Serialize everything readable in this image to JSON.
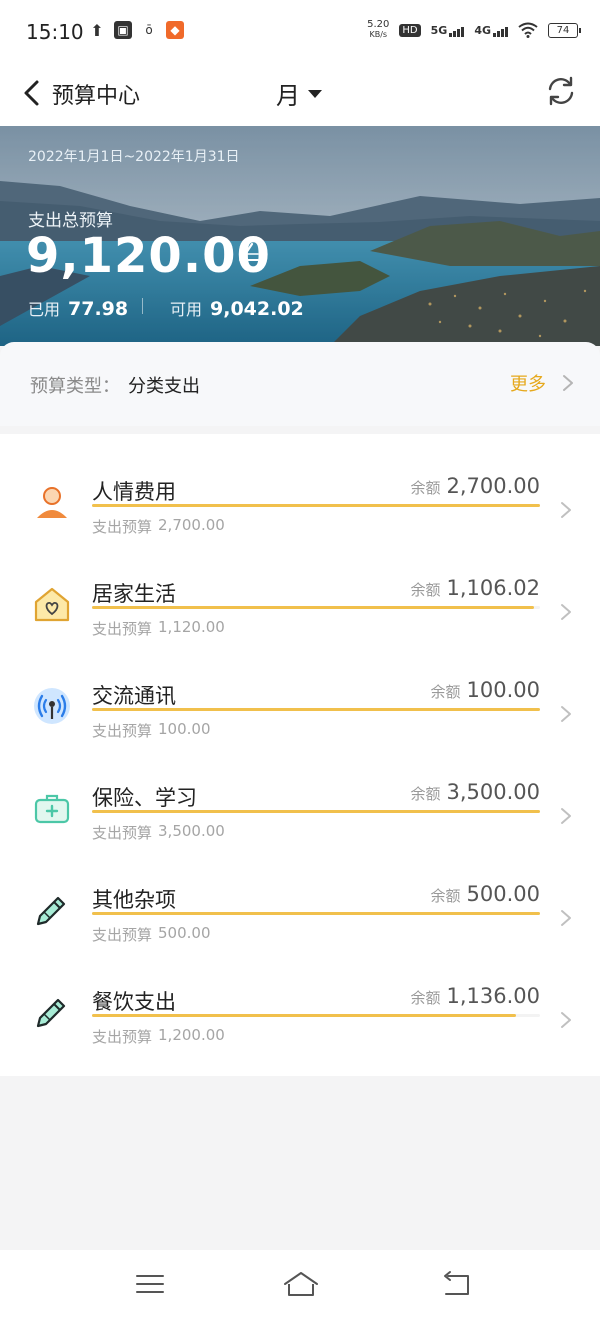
{
  "status_bar": {
    "time": "15:10",
    "speed_value": "5.20",
    "speed_unit": "KB/s",
    "hd_label": "HD",
    "network_1": "5G",
    "network_2": "4G",
    "battery": "74"
  },
  "nav": {
    "title": "预算中心",
    "period": "月",
    "icons": [
      "back-icon",
      "caret-down-icon",
      "refresh-icon"
    ]
  },
  "banner": {
    "date_range": "2022年1月1日~2022年1月31日",
    "total_label": "支出总预算",
    "total_amount": "9,120.00",
    "used_label": "已用",
    "used_value": "77.98",
    "available_label": "可用",
    "available_value": "9,042.02"
  },
  "budget_type": {
    "label": "预算类型：",
    "value": "分类支出",
    "more": "更多"
  },
  "categories": [
    {
      "name": "人情费用",
      "remain_label": "余额",
      "remain": "2,700.00",
      "budget_label": "支出预算",
      "budget": "2,700.00",
      "remaining_fraction": 1.0,
      "icon": "person-icon"
    },
    {
      "name": "居家生活",
      "remain_label": "余额",
      "remain": "1,106.02",
      "budget_label": "支出预算",
      "budget": "1,120.00",
      "remaining_fraction": 0.9875,
      "icon": "home-heart-icon"
    },
    {
      "name": "交流通讯",
      "remain_label": "余额",
      "remain": "100.00",
      "budget_label": "支出预算",
      "budget": "100.00",
      "remaining_fraction": 1.0,
      "icon": "signal-tower-icon"
    },
    {
      "name": "保险、学习",
      "remain_label": "余额",
      "remain": "3,500.00",
      "budget_label": "支出预算",
      "budget": "3,500.00",
      "remaining_fraction": 1.0,
      "icon": "medical-kit-icon"
    },
    {
      "name": "其他杂项",
      "remain_label": "余额",
      "remain": "500.00",
      "budget_label": "支出预算",
      "budget": "500.00",
      "remaining_fraction": 1.0,
      "icon": "pencil-icon"
    },
    {
      "name": "餐饮支出",
      "remain_label": "余额",
      "remain": "1,136.00",
      "budget_label": "支出预算",
      "budget": "1,200.00",
      "remaining_fraction": 0.9467,
      "icon": "pencil-icon"
    }
  ],
  "bottom_nav": [
    "menu-icon",
    "home-icon",
    "back-arrow-icon"
  ],
  "colors": {
    "accent": "#e6a91d",
    "progress": "#f1c04c",
    "text_primary": "#222222",
    "text_secondary": "#a5a5a5"
  }
}
